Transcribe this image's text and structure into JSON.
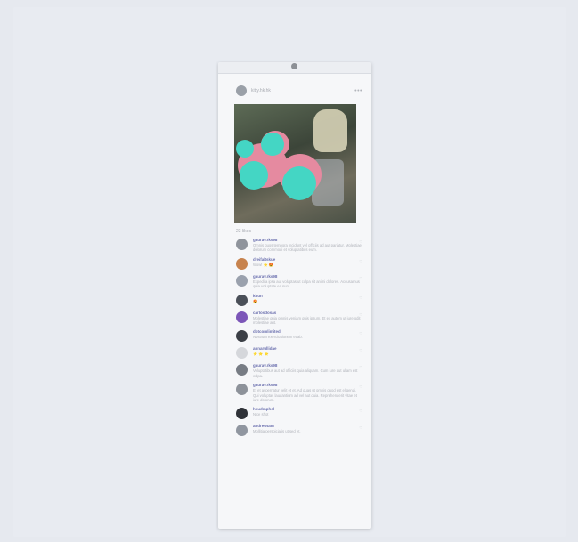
{
  "colors": {
    "background": "#e6e9ef",
    "card": "#f6f7f9",
    "username": "#6a6fae",
    "comment_text": "#b0b3ba",
    "redaction": "#44d6c4"
  },
  "post": {
    "author": "kitty.hk.hk",
    "menu_icon": "more-dots-icon",
    "likes": "23 likes"
  },
  "comments": [
    {
      "user": "gaurav.rks98",
      "text": "Omnis quos tempora incidunt vel officiis ad aut pariatur. Molestiae dolorum commodi et voluptatibus eum."
    },
    {
      "user": "dreifaltskue",
      "text": "Wow! ⭐ 😍"
    },
    {
      "user": "gaurav.rks98",
      "text": "Expedita ipsa aut voluptas ut culpa sit animi dolores. Accusamus quia voluptate ea sunt."
    },
    {
      "user": "kbun",
      "text": "😍"
    },
    {
      "user": "carlosdosas",
      "text": "Molestiae quia omnis veniam quis ipsum. Et ex autem ut iure odit molestiae aut."
    },
    {
      "user": "dotcomlimited",
      "text": "Nostrum exercitationem et ab."
    },
    {
      "user": "annarullidae",
      "text": "⭐ ⭐ ⭐"
    },
    {
      "user": "gaurav.rks98",
      "text": "Voluptatibus aut ad officiis quia aliquam. Cum iure aut ullam est culpa."
    },
    {
      "user": "gaurav.rks98",
      "text": "Et et aspernatur velit et et. Ad quas ut omnis quod est eligendi. Qui voluptas laudantium ad vel aut quia. Reprehenderit vitae et iure dolorum."
    },
    {
      "user": "hcudmphol",
      "text": "Nice shot"
    },
    {
      "user": "andrewtam",
      "text": "Mollitia perspiciatis ut sed et."
    }
  ]
}
